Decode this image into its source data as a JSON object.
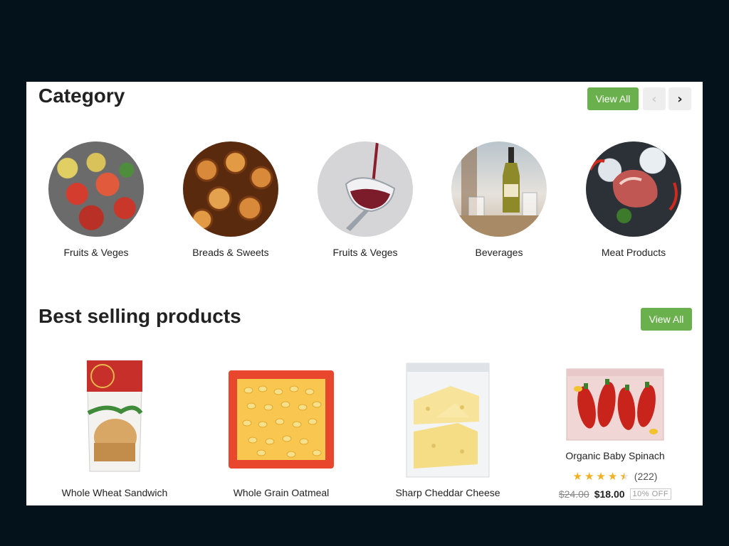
{
  "category_section": {
    "title": "Category",
    "view_all": "View All",
    "prev_symbol": "‹",
    "next_symbol": "›",
    "items": [
      {
        "label": "Fruits & Veges"
      },
      {
        "label": "Breads & Sweets"
      },
      {
        "label": "Fruits & Veges"
      },
      {
        "label": "Beverages"
      },
      {
        "label": "Meat Products"
      }
    ]
  },
  "best_selling": {
    "title": "Best selling products",
    "view_all": "View All",
    "products": [
      {
        "name": "Whole Wheat Sandwich"
      },
      {
        "name": "Whole Grain Oatmeal"
      },
      {
        "name": "Sharp Cheddar Cheese"
      },
      {
        "name": "Organic Baby Spinach",
        "rating": 4.5,
        "rating_count": "(222)",
        "old_price": "$24.00",
        "price": "$18.00",
        "discount": "10% OFF"
      }
    ]
  },
  "colors": {
    "accent": "#6ab04c",
    "star": "#f2b01e",
    "background": "#04121b"
  },
  "icons": [
    "chevron-left-icon",
    "chevron-right-icon",
    "star-icon",
    "half-star-icon"
  ]
}
